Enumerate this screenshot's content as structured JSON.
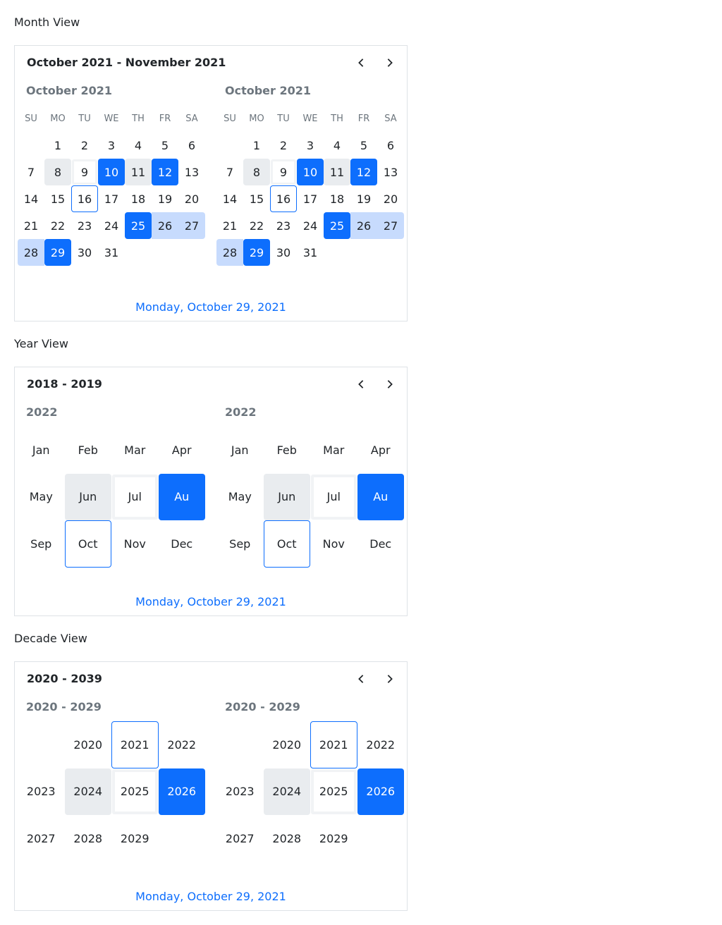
{
  "sections": {
    "month": {
      "label": "Month View",
      "header": "October 2021 - November 2021",
      "panels": [
        {
          "title": "October 2021"
        },
        {
          "title": "October 2021"
        }
      ],
      "weekdays": [
        "SU",
        "MO",
        "TU",
        "WE",
        "TH",
        "FR",
        "SA"
      ],
      "footer": "Monday, October 29, 2021"
    },
    "year": {
      "label": "Year View",
      "header": "2018 - 2019",
      "panels": [
        {
          "title": "2022"
        },
        {
          "title": "2022"
        }
      ],
      "months": [
        "Jan",
        "Feb",
        "Mar",
        "Apr",
        "May",
        "Jun",
        "Jul",
        "Au",
        "Sep",
        "Oct",
        "Nov",
        "Dec"
      ],
      "footer": "Monday, October 29, 2021"
    },
    "decade": {
      "label": "Decade View",
      "header": "2020 - 2039",
      "panels": [
        {
          "title": "2020 - 2029"
        },
        {
          "title": "2020 - 2029"
        }
      ],
      "years": [
        "",
        "2020",
        "2021",
        "2022",
        "2023",
        "2024",
        "2025",
        "2026",
        "2027",
        "2028",
        "2029",
        ""
      ],
      "footer": "Monday, October 29, 2021"
    }
  },
  "month_days": [
    "",
    "1",
    "2",
    "3",
    "4",
    "5",
    "6",
    "7",
    "8",
    "9",
    "10",
    "11",
    "12",
    "13",
    "14",
    "15",
    "16",
    "17",
    "18",
    "19",
    "20",
    "21",
    "22",
    "23",
    "24",
    "25",
    "26",
    "27",
    "28",
    "29",
    "30",
    "31",
    "",
    "",
    "",
    ""
  ],
  "icons": {
    "prev": "chevron-left-icon",
    "next": "chevron-right-icon"
  },
  "colors": {
    "accent": "#0d6efd",
    "range": "#c7dbfd",
    "hover": "#e9ecef",
    "muted": "#6c757d"
  }
}
